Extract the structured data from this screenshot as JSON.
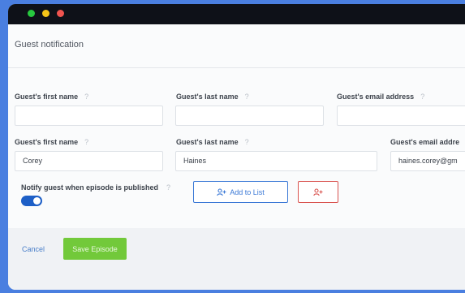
{
  "window": {
    "traffic_lights": [
      {
        "name": "green",
        "color": "#27c93f"
      },
      {
        "name": "yellow",
        "color": "#f5c518"
      },
      {
        "name": "red",
        "color": "#f0544f"
      }
    ]
  },
  "form": {
    "title": "Guest notification",
    "empty_row": {
      "first_name_label": "Guest's first name",
      "last_name_label": "Guest's last name",
      "email_label": "Guest's email address",
      "first_name_value": "",
      "last_name_value": "",
      "email_value": ""
    },
    "filled_row": {
      "first_name_label": "Guest's first name",
      "last_name_label": "Guest's last name",
      "email_label": "Guest's email addre",
      "first_name_value": "Corey",
      "last_name_value": "Haines",
      "email_value": "haines.corey@gm"
    },
    "help_glyph": "?",
    "notify_label": "Notify guest when episode is published",
    "notify_enabled": true,
    "add_to_list_label": "Add to List"
  },
  "footer": {
    "cancel_label": "Cancel",
    "save_label": "Save Episode"
  },
  "colors": {
    "accent": "#3a78d6",
    "danger": "#d9534f",
    "save": "#72c93a",
    "toggle_on": "#1d5fc7"
  },
  "icons": {
    "add_user": "add-user-icon",
    "remove_user": "remove-user-icon"
  }
}
